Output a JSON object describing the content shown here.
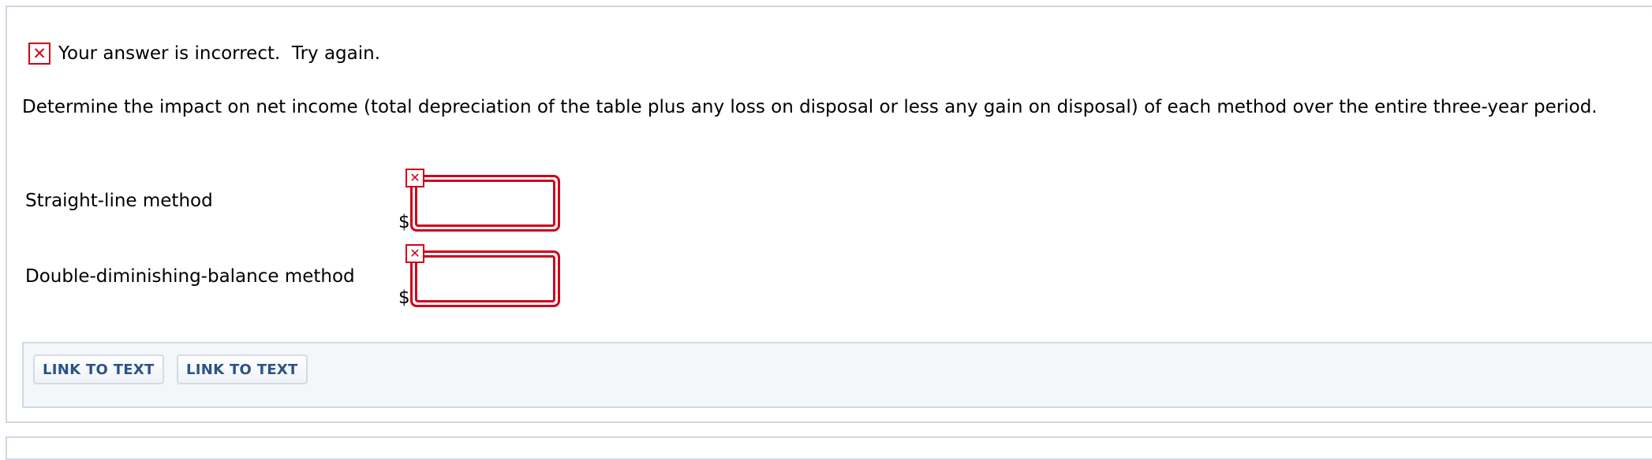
{
  "feedback": {
    "icon": "error-x-icon",
    "text": "Your answer is incorrect.  Try again."
  },
  "question": {
    "text": "Determine the impact on net income (total depreciation of the table plus any loss on disposal or less any gain on disposal) of each method over the entire three-year period."
  },
  "rows": [
    {
      "label": "Straight-line method",
      "currency": "$",
      "value": "",
      "status": "incorrect"
    },
    {
      "label": "Double-diminishing-balance method",
      "currency": "$",
      "value": "",
      "status": "incorrect"
    }
  ],
  "links": [
    {
      "label": "LINK TO TEXT"
    },
    {
      "label": "LINK TO TEXT"
    }
  ],
  "colors": {
    "error": "#d0021b",
    "link_text": "#2a5487",
    "panel_border": "#cfd9e4",
    "links_bar_bg": "#f4f7fa"
  }
}
